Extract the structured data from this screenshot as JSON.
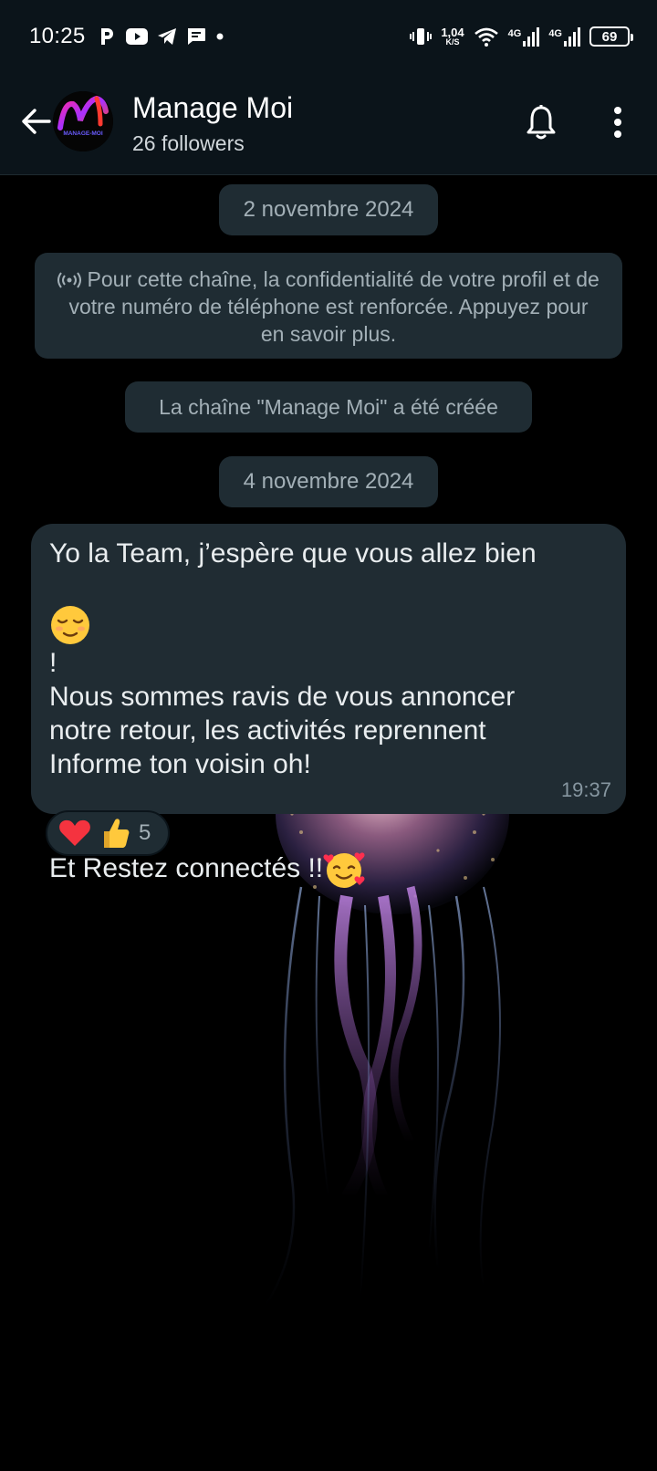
{
  "status_bar": {
    "time": "10:25",
    "net_speed_value": "1,04",
    "net_speed_unit": "K/S",
    "net_label_1": "4G",
    "net_label_2": "4G",
    "battery": "69"
  },
  "header": {
    "channel_name": "Manage Moi",
    "followers": "26 followers",
    "avatar_text": "MANAGE-MOI"
  },
  "chat": {
    "date_1": "2 novembre 2024",
    "privacy_notice": "Pour cette chaîne, la confidentialité de votre profil et de votre numéro de téléphone est renforcée. Appuyez pour en savoir plus.",
    "created_notice": "La chaîne \"Manage Moi\" a été créée",
    "date_2": "4 novembre 2024",
    "message": {
      "line_1": "Yo la Team, j’espère que vous allez bien",
      "line_1b": "!",
      "line_2": "Nous sommes ravis de vous annoncer notre retour, les activités reprennent Informe ton voisin oh!",
      "line_3": "Et Restez connectés !!",
      "time": "19:37"
    },
    "reactions": {
      "count": "5",
      "emojis": [
        "heart",
        "thumbs-up"
      ]
    }
  },
  "colors": {
    "header_bg": "#0b141a",
    "bubble_bg": "#202c33",
    "system_pill_bg": "#1f2c33",
    "muted_text": "#a3b0b7"
  }
}
